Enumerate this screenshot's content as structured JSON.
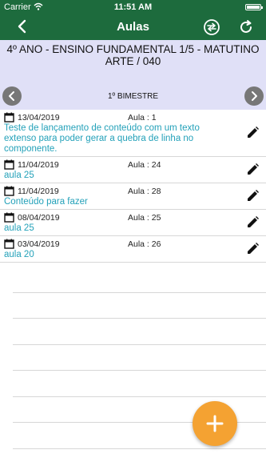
{
  "status_bar": {
    "carrier": "Carrier",
    "time": "11:51 AM"
  },
  "navbar": {
    "title": "Aulas"
  },
  "class": {
    "name_line1": "4º ANO - ENSINO FUNDAMENTAL 1/5 - MATUTINO",
    "name_line2": "ARTE / 040"
  },
  "period": {
    "label": "1º BIMESTRE"
  },
  "lessons": [
    {
      "date": "13/04/2019",
      "aula": "Aula : 1",
      "content": "Teste de lançamento de conteúdo com um texto extenso para poder gerar a quebra de linha no componente."
    },
    {
      "date": "11/04/2019",
      "aula": "Aula : 24",
      "content": "aula 25"
    },
    {
      "date": "11/04/2019",
      "aula": "Aula : 28",
      "content": "Conteúdo para fazer"
    },
    {
      "date": "08/04/2019",
      "aula": "Aula : 25",
      "content": "aula 25"
    },
    {
      "date": "03/04/2019",
      "aula": "Aula : 26",
      "content": "aula 20"
    }
  ],
  "colors": {
    "header": "#1d6b3d",
    "accent_text": "#23a1b9",
    "fab": "#f4a232",
    "class_bg": "#e0e0f7"
  },
  "icons": {
    "back": "chevron-left-icon",
    "sync": "sync-icon",
    "refresh": "refresh-icon",
    "calendar": "calendar-icon",
    "edit": "pencil-icon",
    "add": "plus-icon"
  }
}
